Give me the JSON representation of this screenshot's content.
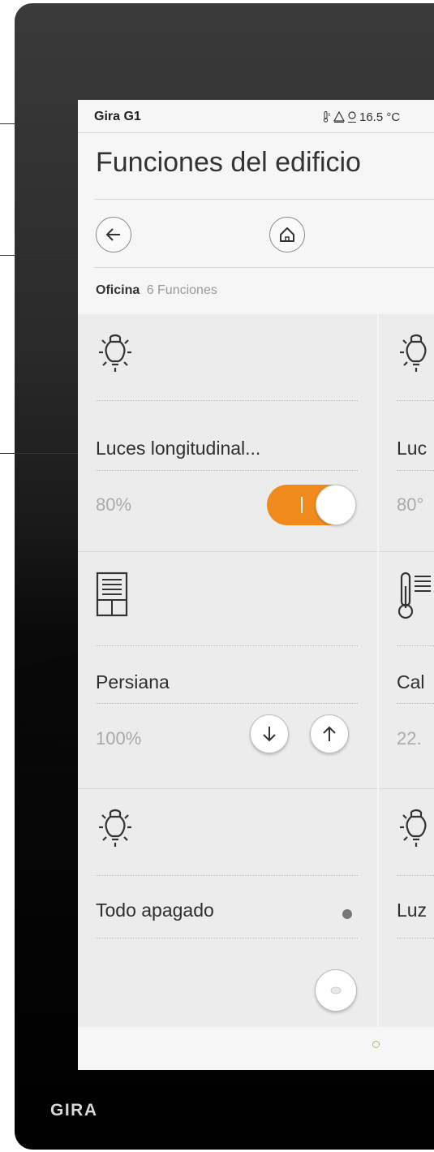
{
  "brand": "GIRA",
  "status": {
    "device_name": "Gira G1",
    "temperature": "16.5 °C"
  },
  "page_title": "Funciones del edificio",
  "breadcrumb": {
    "room": "Oficina",
    "count": "6 Funciones"
  },
  "tiles": [
    {
      "label": "Luces longitudinal...",
      "value": "80%",
      "icon": "light-bulb-icon",
      "control": "toggle",
      "toggle_on": true
    },
    {
      "label": "Luc",
      "value": "80°",
      "icon": "light-bulb-icon"
    },
    {
      "label": "Persiana",
      "value": "100%",
      "icon": "blind-icon",
      "control": "up-down"
    },
    {
      "label": "Cal",
      "value": "22.",
      "icon": "thermometer-icon"
    },
    {
      "label": "Todo apagado",
      "value": "",
      "icon": "light-bulb-icon",
      "control": "scene-button"
    },
    {
      "label": "Luz",
      "value": "",
      "icon": "light-bulb-icon"
    }
  ],
  "colors": {
    "accent": "#f08a1c",
    "tile_bg": "#ececec",
    "page_indicator": "#9bc65a"
  }
}
